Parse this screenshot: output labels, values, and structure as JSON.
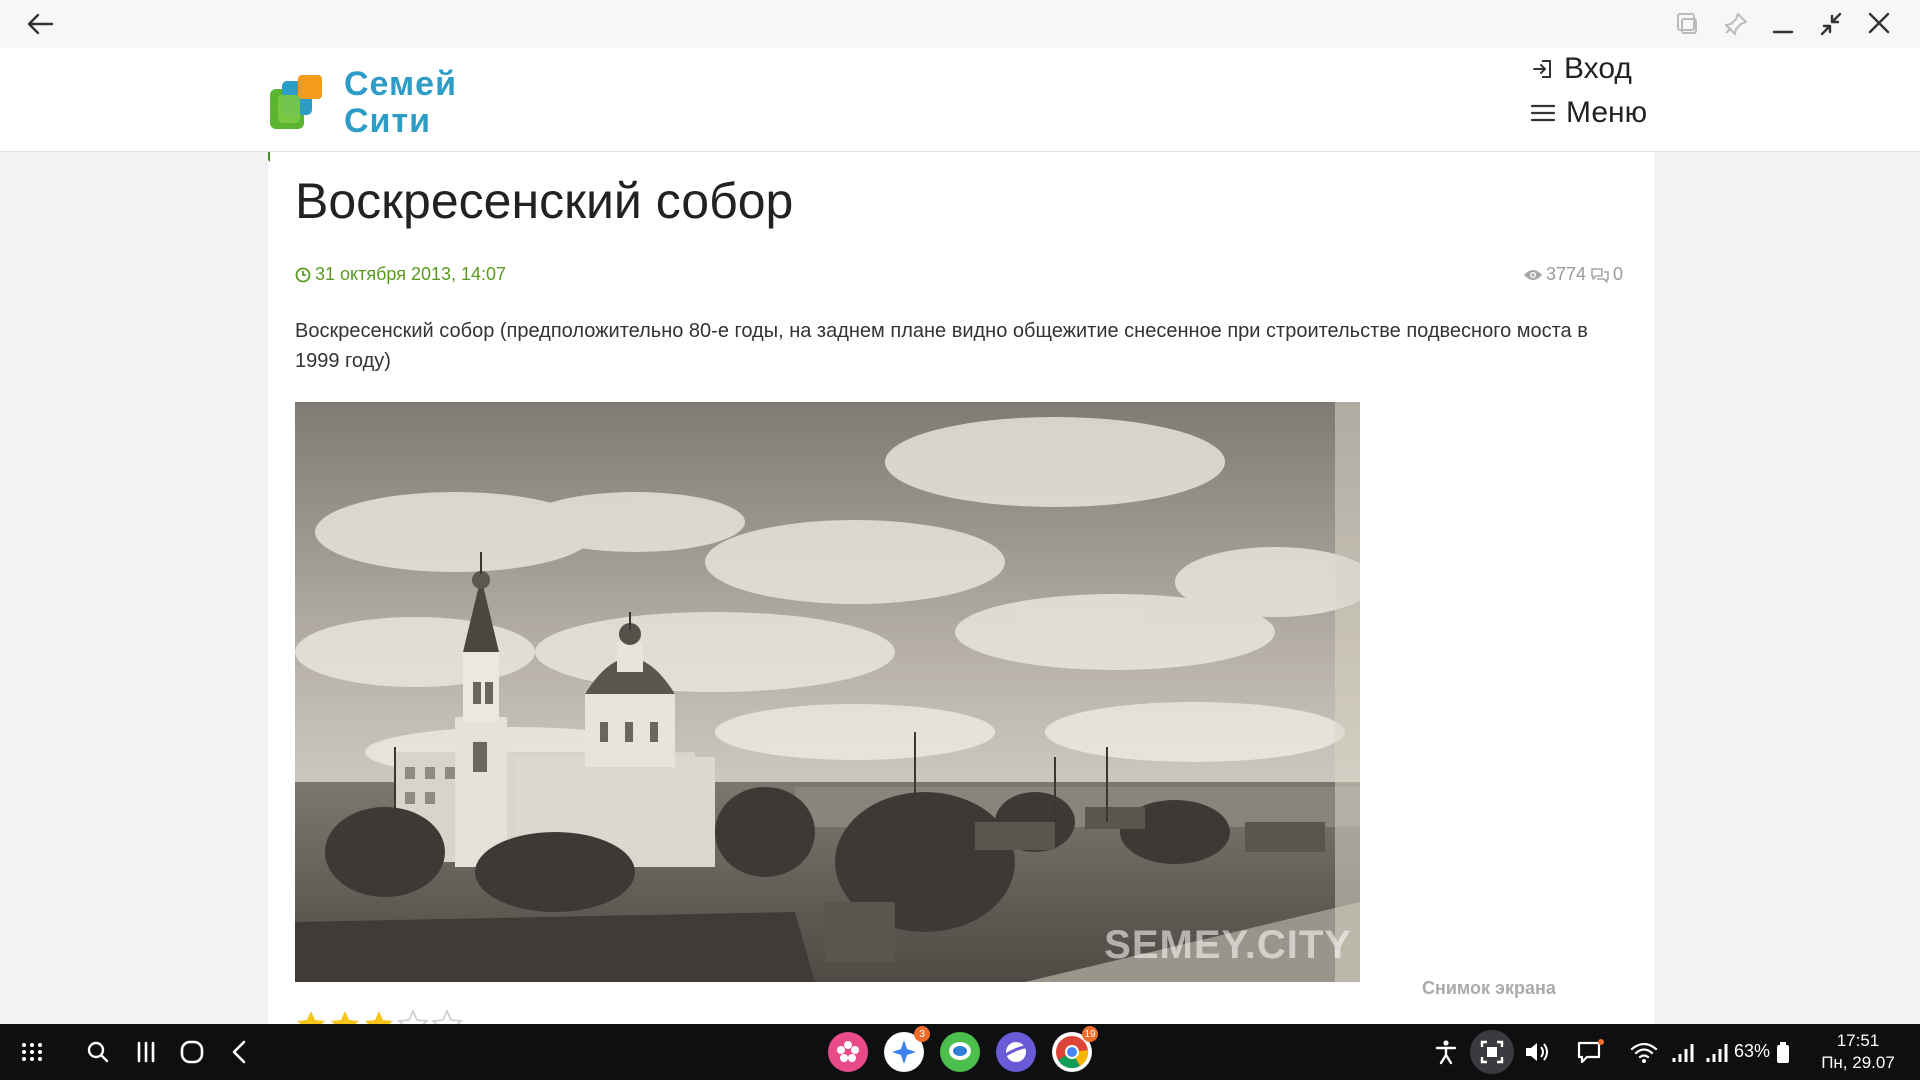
{
  "header": {
    "logo_line1": "Семей",
    "logo_line2": "Сити",
    "login_label": "Вход",
    "menu_label": "Меню"
  },
  "article": {
    "title": "Воскресенский собор",
    "date": "31 октября 2013, 14:07",
    "views": "3774",
    "comments": "0",
    "description": "Воскресенский собор (предположительно 80-е годы, на заднем плане видно общежитие снесенное при строительстве подвесного моста в 1999 году)",
    "image_watermark": "SEMEY.CITY",
    "rating_stars_filled": 3,
    "rating_stars_total": 5
  },
  "screenshot_tip": "Снимок экрана",
  "taskbar": {
    "battery": "63%",
    "time": "17:51",
    "date": "Пн, 29.07",
    "apps": [
      {
        "name": "flower-app-icon",
        "color": "#e84b8a",
        "badge": ""
      },
      {
        "name": "assistant-app-icon",
        "color": "#ffffff",
        "badge": "3"
      },
      {
        "name": "messages-app-icon",
        "color": "#4cbf4c",
        "badge": ""
      },
      {
        "name": "internet-app-icon",
        "color": "#6a5ad8",
        "badge": ""
      },
      {
        "name": "chrome-app-icon",
        "color": "#ffffff",
        "badge": "19"
      }
    ]
  },
  "colors": {
    "logo_blue": "#2d9cc6",
    "date_green": "#5a9a1e",
    "muted_gray": "#9a9a9a"
  }
}
